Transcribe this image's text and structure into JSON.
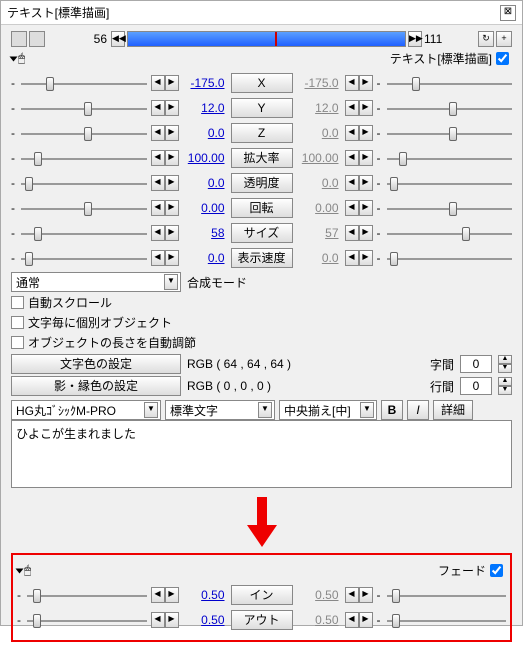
{
  "title": "テキスト[標準描画]",
  "timeline": {
    "start": 56,
    "end": 111
  },
  "section_label": "テキスト[標準描画]",
  "params": [
    {
      "label": "X",
      "left": "-175.0",
      "right": "-175.0",
      "lp": 20,
      "rp": 20
    },
    {
      "label": "Y",
      "left": "12.0",
      "right": "12.0",
      "lp": 50,
      "rp": 50
    },
    {
      "label": "Z",
      "left": "0.0",
      "right": "0.0",
      "lp": 50,
      "rp": 50
    },
    {
      "label": "拡大率",
      "left": "100.00",
      "right": "100.00",
      "lp": 10,
      "rp": 10
    },
    {
      "label": "透明度",
      "left": "0.0",
      "right": "0.0",
      "lp": 3,
      "rp": 3
    },
    {
      "label": "回転",
      "left": "0.00",
      "right": "0.00",
      "lp": 50,
      "rp": 50
    },
    {
      "label": "サイズ",
      "left": "58",
      "right": "57",
      "lp": 10,
      "rp": 60
    },
    {
      "label": "表示速度",
      "left": "0.0",
      "right": "0.0",
      "lp": 3,
      "rp": 3
    }
  ],
  "blend": {
    "label": "合成モード",
    "value": "通常"
  },
  "checks": {
    "autoscroll": "自動スクロール",
    "perchar": "文字毎に個別オブジェクト",
    "autolen": "オブジェクトの長さを自動調節"
  },
  "color": {
    "btn1": "文字色の設定",
    "val1": "RGB ( 64 , 64 , 64 )",
    "btn2": "影・縁色の設定",
    "val2": "RGB ( 0 , 0 , 0 )"
  },
  "spacing": {
    "char_label": "字間",
    "char": "0",
    "line_label": "行間",
    "line": "0"
  },
  "font": {
    "name": "HG丸ｺﾞｼｯｸM-PRO",
    "style": "標準文字",
    "align": "中央揃え[中]"
  },
  "format_btns": {
    "b": "B",
    "i": "I",
    "detail": "詳細"
  },
  "text": "ひよこが生まれました",
  "fade": {
    "label": "フェード",
    "rows": [
      {
        "label": "イン",
        "left": "0.50",
        "right": "0.50",
        "lp": 5,
        "rp": 5
      },
      {
        "label": "アウト",
        "left": "0.50",
        "right": "0.50",
        "lp": 5,
        "rp": 5
      }
    ]
  }
}
